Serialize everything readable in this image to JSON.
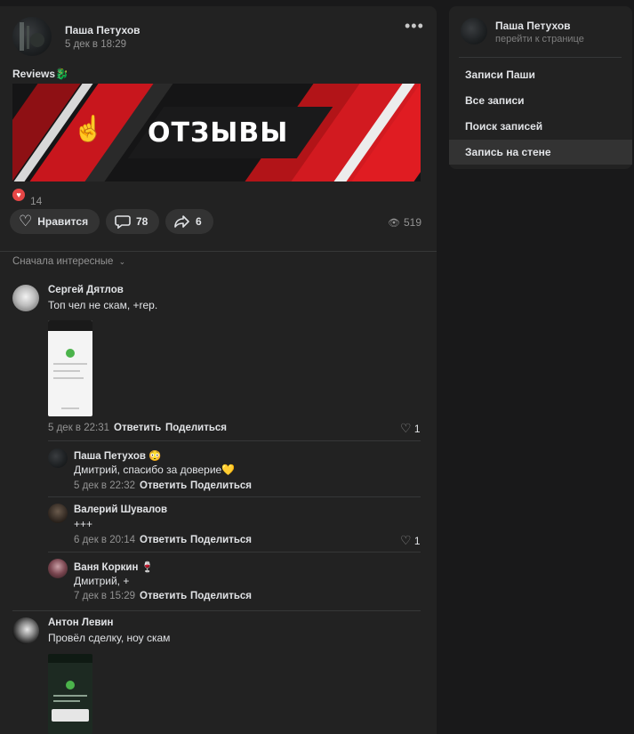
{
  "post": {
    "author": "Паша Петухов",
    "date": "5 дек в 18:29",
    "text": "Reviews",
    "text_emoji": "🐉",
    "banner_title": "ОТЗЫВЫ",
    "reactions_count": "14",
    "like_label": "Нравится",
    "comments_count": "78",
    "shares_count": "6",
    "views": "519",
    "more_icon": "more-dots-icon"
  },
  "comments_sort": "Сначала интересные",
  "comments": [
    {
      "author": "Сергей Дятлов",
      "text": "Топ чел не скам, +rep.",
      "date": "5 дек в 22:31",
      "reply": "Ответить",
      "share": "Поделиться",
      "likes": "1"
    },
    {
      "author": "Паша Петухов",
      "author_emoji": "😳",
      "text": "Дмитрий, спасибо за доверие💛",
      "date": "5 дек в 22:32",
      "reply": "Ответить",
      "share": "Поделиться"
    },
    {
      "author": "Валерий Шувалов",
      "text": "+++",
      "date": "6 дек в 20:14",
      "reply": "Ответить",
      "share": "Поделиться",
      "likes": "1"
    },
    {
      "author": "Ваня Коркин",
      "author_emoji": "🍷",
      "text": "Дмитрий, +",
      "date": "7 дек в 15:29",
      "reply": "Ответить",
      "share": "Поделиться"
    },
    {
      "author": "Антон Левин",
      "text": "Провёл сделку, ноу скам"
    }
  ],
  "sidebar": {
    "name": "Паша Петухов",
    "subtitle": "перейти к странице",
    "items": [
      {
        "label": "Записи Паши"
      },
      {
        "label": "Все записи"
      },
      {
        "label": "Поиск записей"
      },
      {
        "label": "Запись на стене",
        "active": true
      }
    ]
  },
  "colors": {
    "background": "#19191a",
    "card": "#222222",
    "pill": "#333333",
    "accent_red": "#c8161d",
    "like_red": "#e64646",
    "muted": "#939393"
  }
}
